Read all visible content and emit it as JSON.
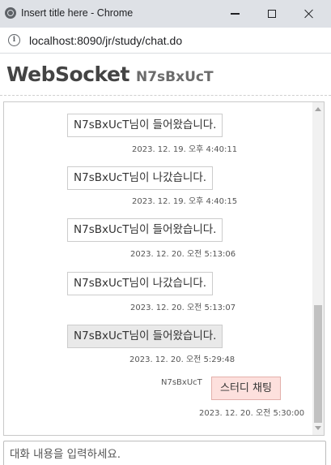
{
  "window": {
    "title": "Insert title here - Chrome",
    "url": "localhost:8090/jr/study/chat.do"
  },
  "header": {
    "title": "WebSocket",
    "username": "N7sBxUcT"
  },
  "messages": [
    {
      "type": "system",
      "text": "N7sBxUcT님이 들어왔습니다.",
      "time": "2023. 12. 19. 오후 4:40:11"
    },
    {
      "type": "system",
      "text": "N7sBxUcT님이 나갔습니다.",
      "time": "2023. 12. 19. 오후 4:40:15"
    },
    {
      "type": "system",
      "text": "N7sBxUcT님이 들어왔습니다.",
      "time": "2023. 12. 20. 오전 5:13:06"
    },
    {
      "type": "system",
      "text": "N7sBxUcT님이 나갔습니다.",
      "time": "2023. 12. 20. 오전 5:13:07"
    },
    {
      "type": "system",
      "text": "N7sBxUcT님이 들어왔습니다.",
      "time": "2023. 12. 20. 오전 5:29:48",
      "highlighted": true
    },
    {
      "type": "mine",
      "sender": "N7sBxUcT",
      "text": "스터디 채팅",
      "time": "2023. 12. 20. 오전 5:30:00"
    }
  ],
  "input": {
    "placeholder": "대화 내용을 입력하세요."
  },
  "colors": {
    "my_message_bg": "#fde0dd",
    "my_message_border": "#e3b0ab",
    "highlight_bg": "#e9e9e9",
    "titlebar_bg": "#dee1e6"
  },
  "icons": {
    "app": "chrome-icon",
    "site_info": "info-icon",
    "minimize": "minimize-icon",
    "maximize": "maximize-icon",
    "close": "close-icon"
  }
}
